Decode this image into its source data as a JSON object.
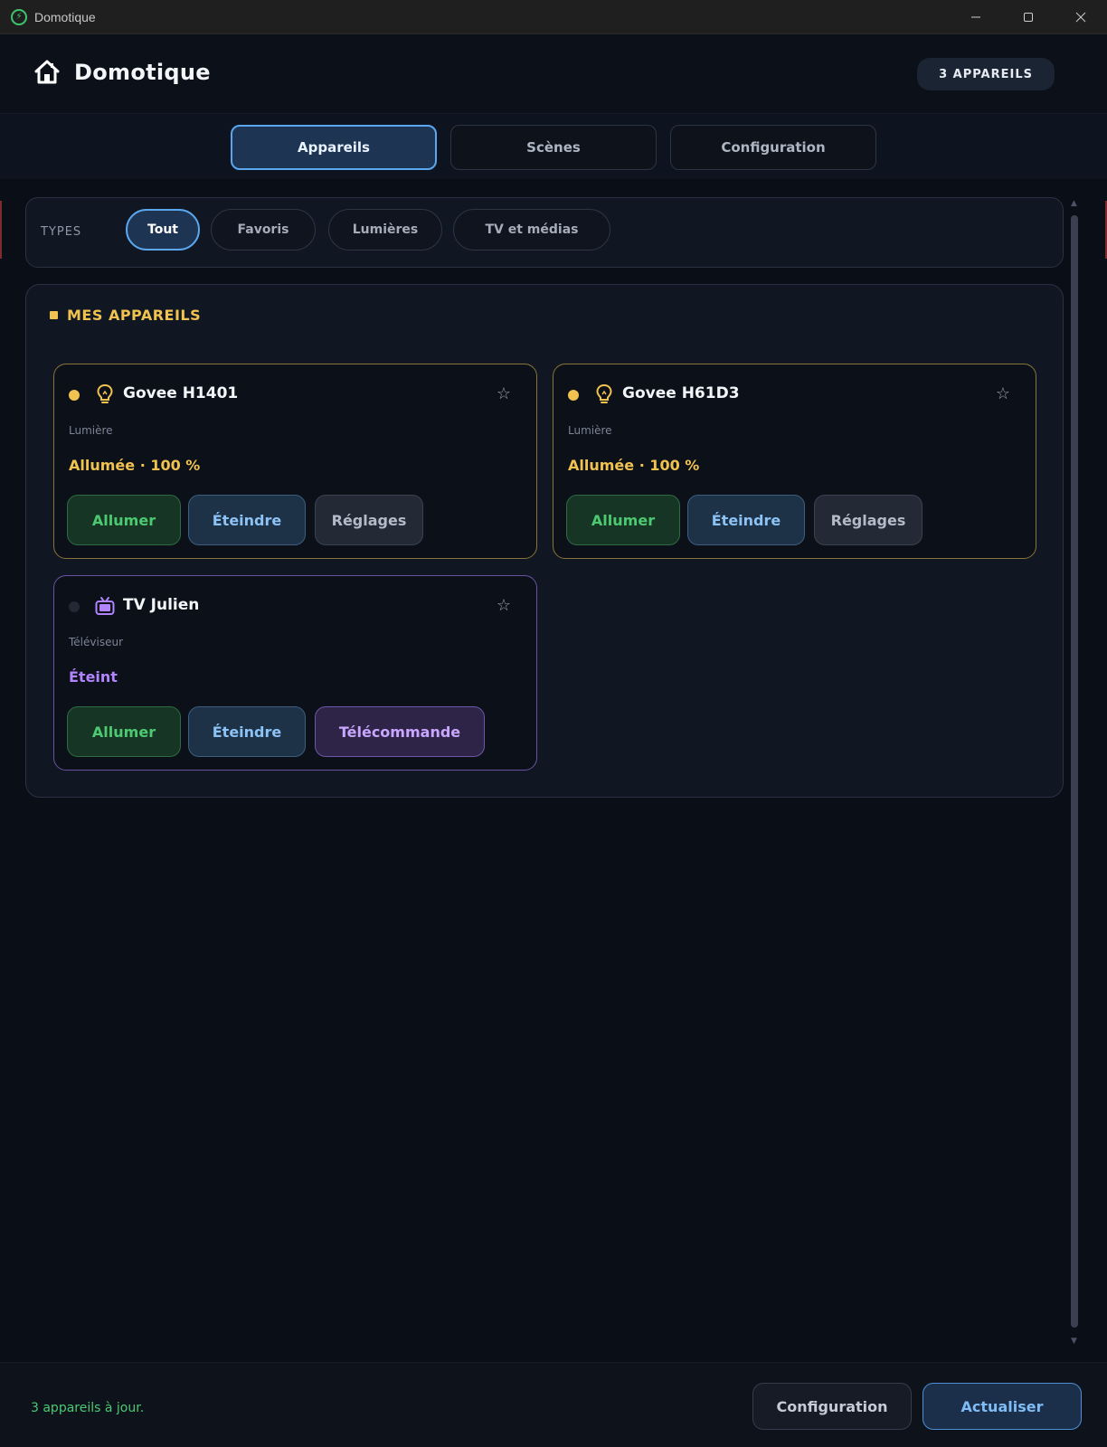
{
  "window": {
    "title": "Domotique",
    "app_icon": "lightning-icon",
    "controls": [
      "minimize-icon",
      "maximize-icon",
      "close-icon"
    ]
  },
  "header": {
    "title": "Domotique",
    "icon": "house-icon",
    "device_count_badge": "3 APPAREILS"
  },
  "tabs": [
    {
      "label": "Appareils",
      "active": true
    },
    {
      "label": "Scènes",
      "active": false
    },
    {
      "label": "Configuration",
      "active": false
    }
  ],
  "filters": {
    "label": "TYPES",
    "chips": [
      {
        "label": "Tout",
        "active": true
      },
      {
        "label": "Favoris",
        "active": false
      },
      {
        "label": "Lumières",
        "active": false
      },
      {
        "label": "TV et médias",
        "active": false
      }
    ]
  },
  "devices_section": {
    "title": "MES APPAREILS",
    "devices": [
      {
        "name": "Govee H1401",
        "type": "Lumière",
        "icon": "lightbulb-icon",
        "status": "Allumée · 100 %",
        "indicator": "on",
        "favorite_icon": "star-icon",
        "buttons": [
          "Allumer",
          "Éteindre",
          "Réglages"
        ]
      },
      {
        "name": "Govee H61D3",
        "type": "Lumière",
        "icon": "lightbulb-icon",
        "status": "Allumée · 100 %",
        "indicator": "on",
        "favorite_icon": "star-icon",
        "buttons": [
          "Allumer",
          "Éteindre",
          "Réglages"
        ]
      },
      {
        "name": "TV Julien",
        "type": "Téléviseur",
        "icon": "tv-icon",
        "status": "Éteint",
        "indicator": "off",
        "favorite_icon": "star-icon",
        "buttons": [
          "Allumer",
          "Éteindre",
          "Télécommande"
        ]
      }
    ]
  },
  "footer": {
    "status_message": "3 appareils à jour.",
    "config_button": "Configuration",
    "refresh_button": "Actualiser"
  },
  "colors": {
    "accent": "#5aa6ef",
    "light_accent": "#f0c250",
    "tv_accent": "#b285ff",
    "success": "#4cc971"
  }
}
